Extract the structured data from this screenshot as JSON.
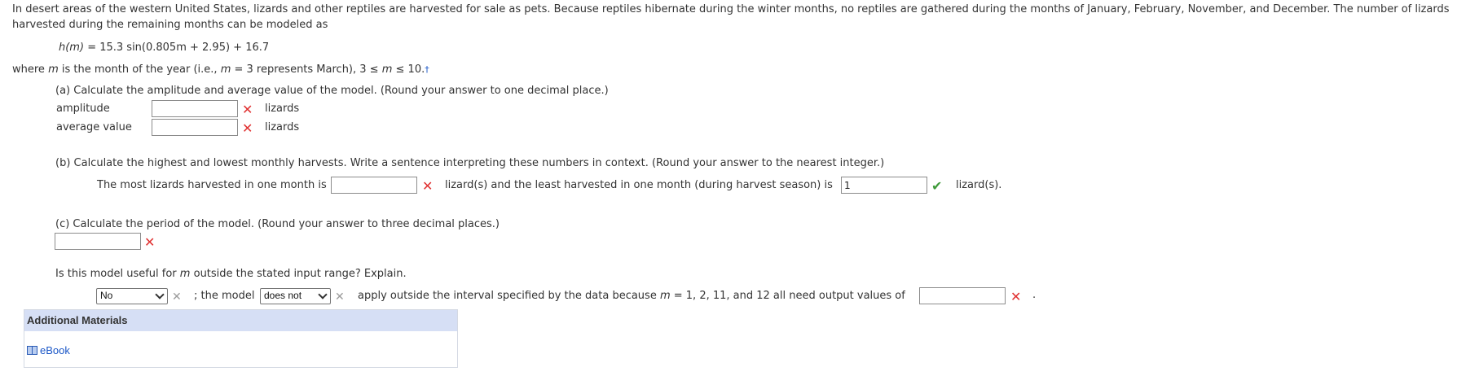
{
  "intro": {
    "line1": "In desert areas of the western United States, lizards and other reptiles are harvested for sale as pets. Because reptiles hibernate during the winter months, no reptiles are gathered during the months of January, February, November, and December. The number of lizards",
    "line2": "harvested during the remaining months can be modeled as",
    "formula_lhs": "h(m)",
    "formula_rhs": "= 15.3 sin(0.805m + 2.95) + 16.7",
    "where_text": "where",
    "where_var": "m",
    "where_rest": "is the month of the year (i.e.,",
    "where_m": "m",
    "where_example": "= 3  represents March),  3 ≤",
    "where_m2": "m",
    "where_range": "≤ 10.",
    "footnote_mark": "†"
  },
  "part_a": {
    "question": "(a) Calculate the amplitude and average value of the model. (Round your answer to one decimal place.)",
    "amplitude_label": "amplitude",
    "amplitude_value": "",
    "amplitude_unit": "lizards",
    "average_label": "average value",
    "average_value": "",
    "average_unit": "lizards"
  },
  "part_b": {
    "question": "(b) Calculate the highest and lowest monthly harvests. Write a sentence interpreting these numbers in context. (Round your answer to the nearest integer.)",
    "sentence_start": "The most lizards harvested in one month is",
    "most_value": "",
    "sentence_mid": "lizard(s) and the least harvested in one month (during harvest season) is",
    "least_value": "1",
    "sentence_end": "lizard(s)."
  },
  "part_c": {
    "question": "(c) Calculate the period of the model. (Round your answer to three decimal places.)",
    "period_value": ""
  },
  "part_d": {
    "question_start": "Is this model useful for",
    "question_var": "m",
    "question_end": "outside the stated input range? Explain.",
    "select1_value": "No",
    "text_mid": "; the model",
    "select2_value": "does not",
    "text_after": "apply outside the interval specified by the data because",
    "text_m": "m",
    "text_values": "= 1, 2, 11, and 12  all need output values of",
    "output_value": "",
    "period_end": "."
  },
  "additional": {
    "header": "Additional Materials",
    "ebook_label": "eBook"
  },
  "colors": {
    "incorrect": "#e03131",
    "correct": "#3f9a3a",
    "panel_header": "#d6dff5",
    "link": "#1a56c7"
  }
}
